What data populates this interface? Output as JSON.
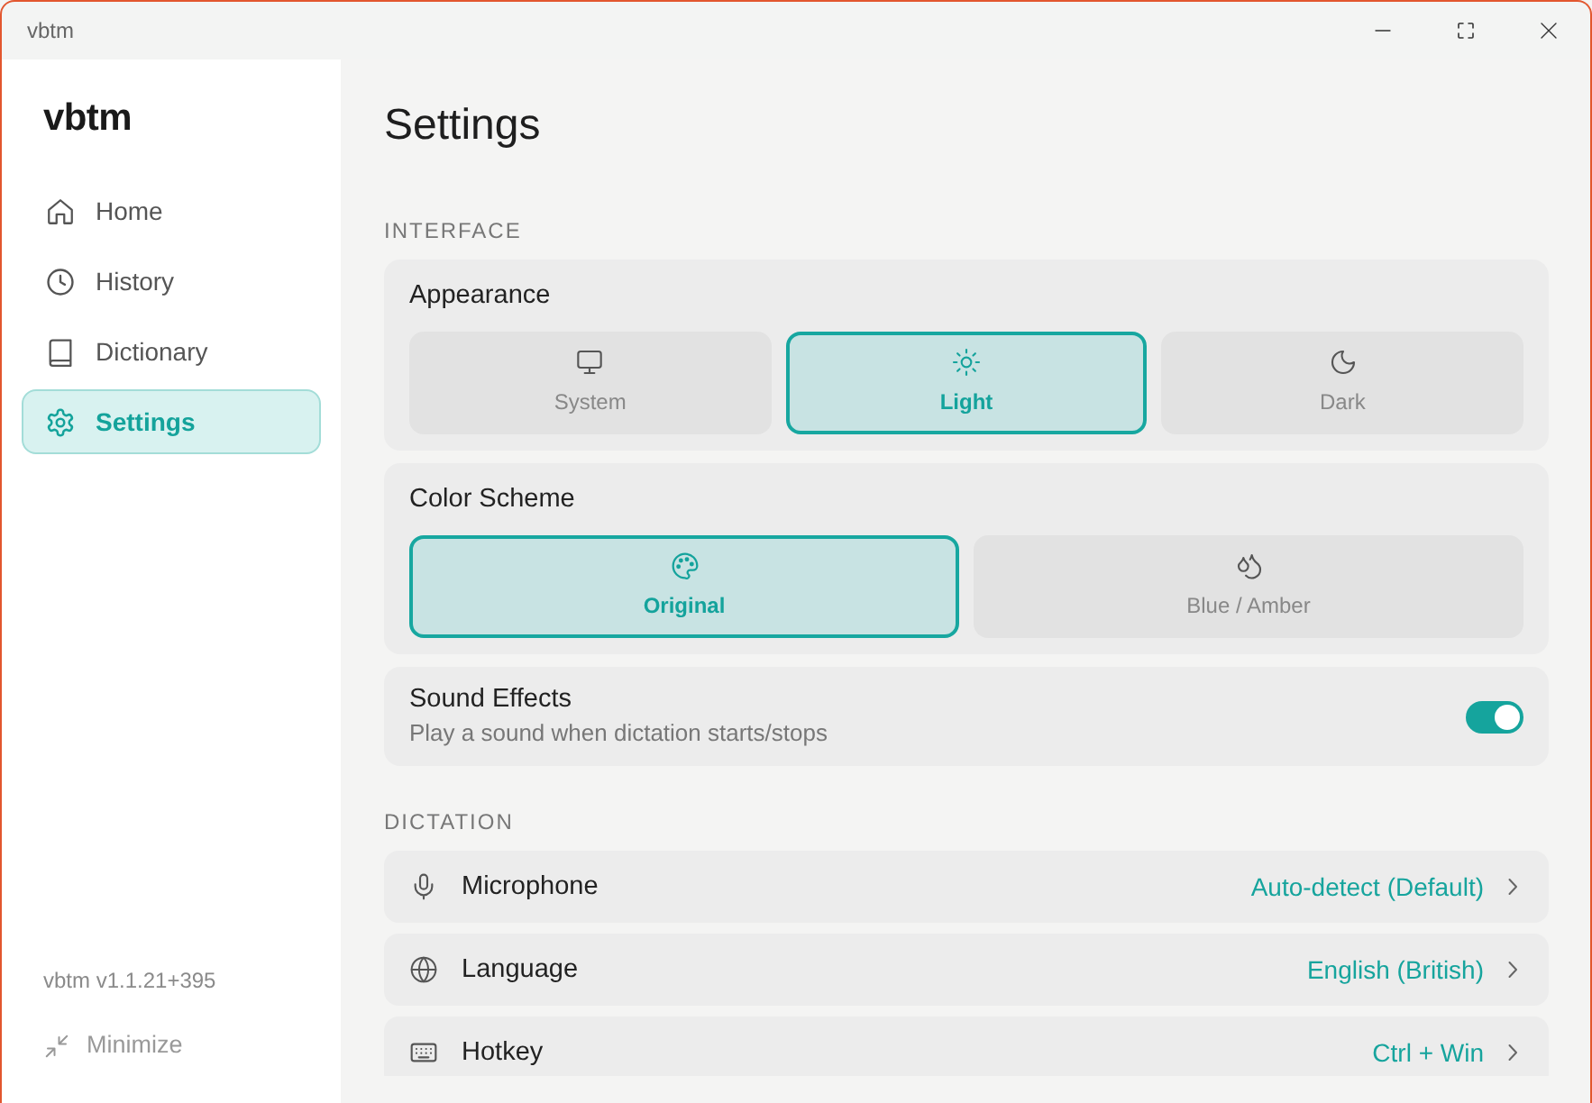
{
  "window": {
    "title": "vbtm"
  },
  "sidebar": {
    "logo": "vbtm",
    "items": [
      {
        "label": "Home",
        "selected": false
      },
      {
        "label": "History",
        "selected": false
      },
      {
        "label": "Dictionary",
        "selected": false
      },
      {
        "label": "Settings",
        "selected": true
      }
    ],
    "version": "vbtm v1.1.21+395",
    "minimize": "Minimize"
  },
  "page": {
    "title": "Settings"
  },
  "sections": [
    {
      "heading": "INTERFACE",
      "cards": [
        {
          "kind": "choice",
          "title": "Appearance",
          "options": [
            {
              "label": "System",
              "selected": false
            },
            {
              "label": "Light",
              "selected": true
            },
            {
              "label": "Dark",
              "selected": false
            }
          ]
        },
        {
          "kind": "choice",
          "title": "Color Scheme",
          "options": [
            {
              "label": "Original",
              "selected": true
            },
            {
              "label": "Blue / Amber",
              "selected": false
            }
          ]
        },
        {
          "kind": "toggle",
          "title": "Sound Effects",
          "description": "Play a sound when dictation starts/stops",
          "on": true
        }
      ]
    },
    {
      "heading": "DICTATION",
      "cards": [
        {
          "kind": "link",
          "title": "Microphone",
          "value": "Auto-detect (Default)"
        },
        {
          "kind": "link",
          "title": "Language",
          "value": "English (British)"
        },
        {
          "kind": "link",
          "title": "Hotkey",
          "value": "Ctrl + Win"
        }
      ]
    }
  ]
}
